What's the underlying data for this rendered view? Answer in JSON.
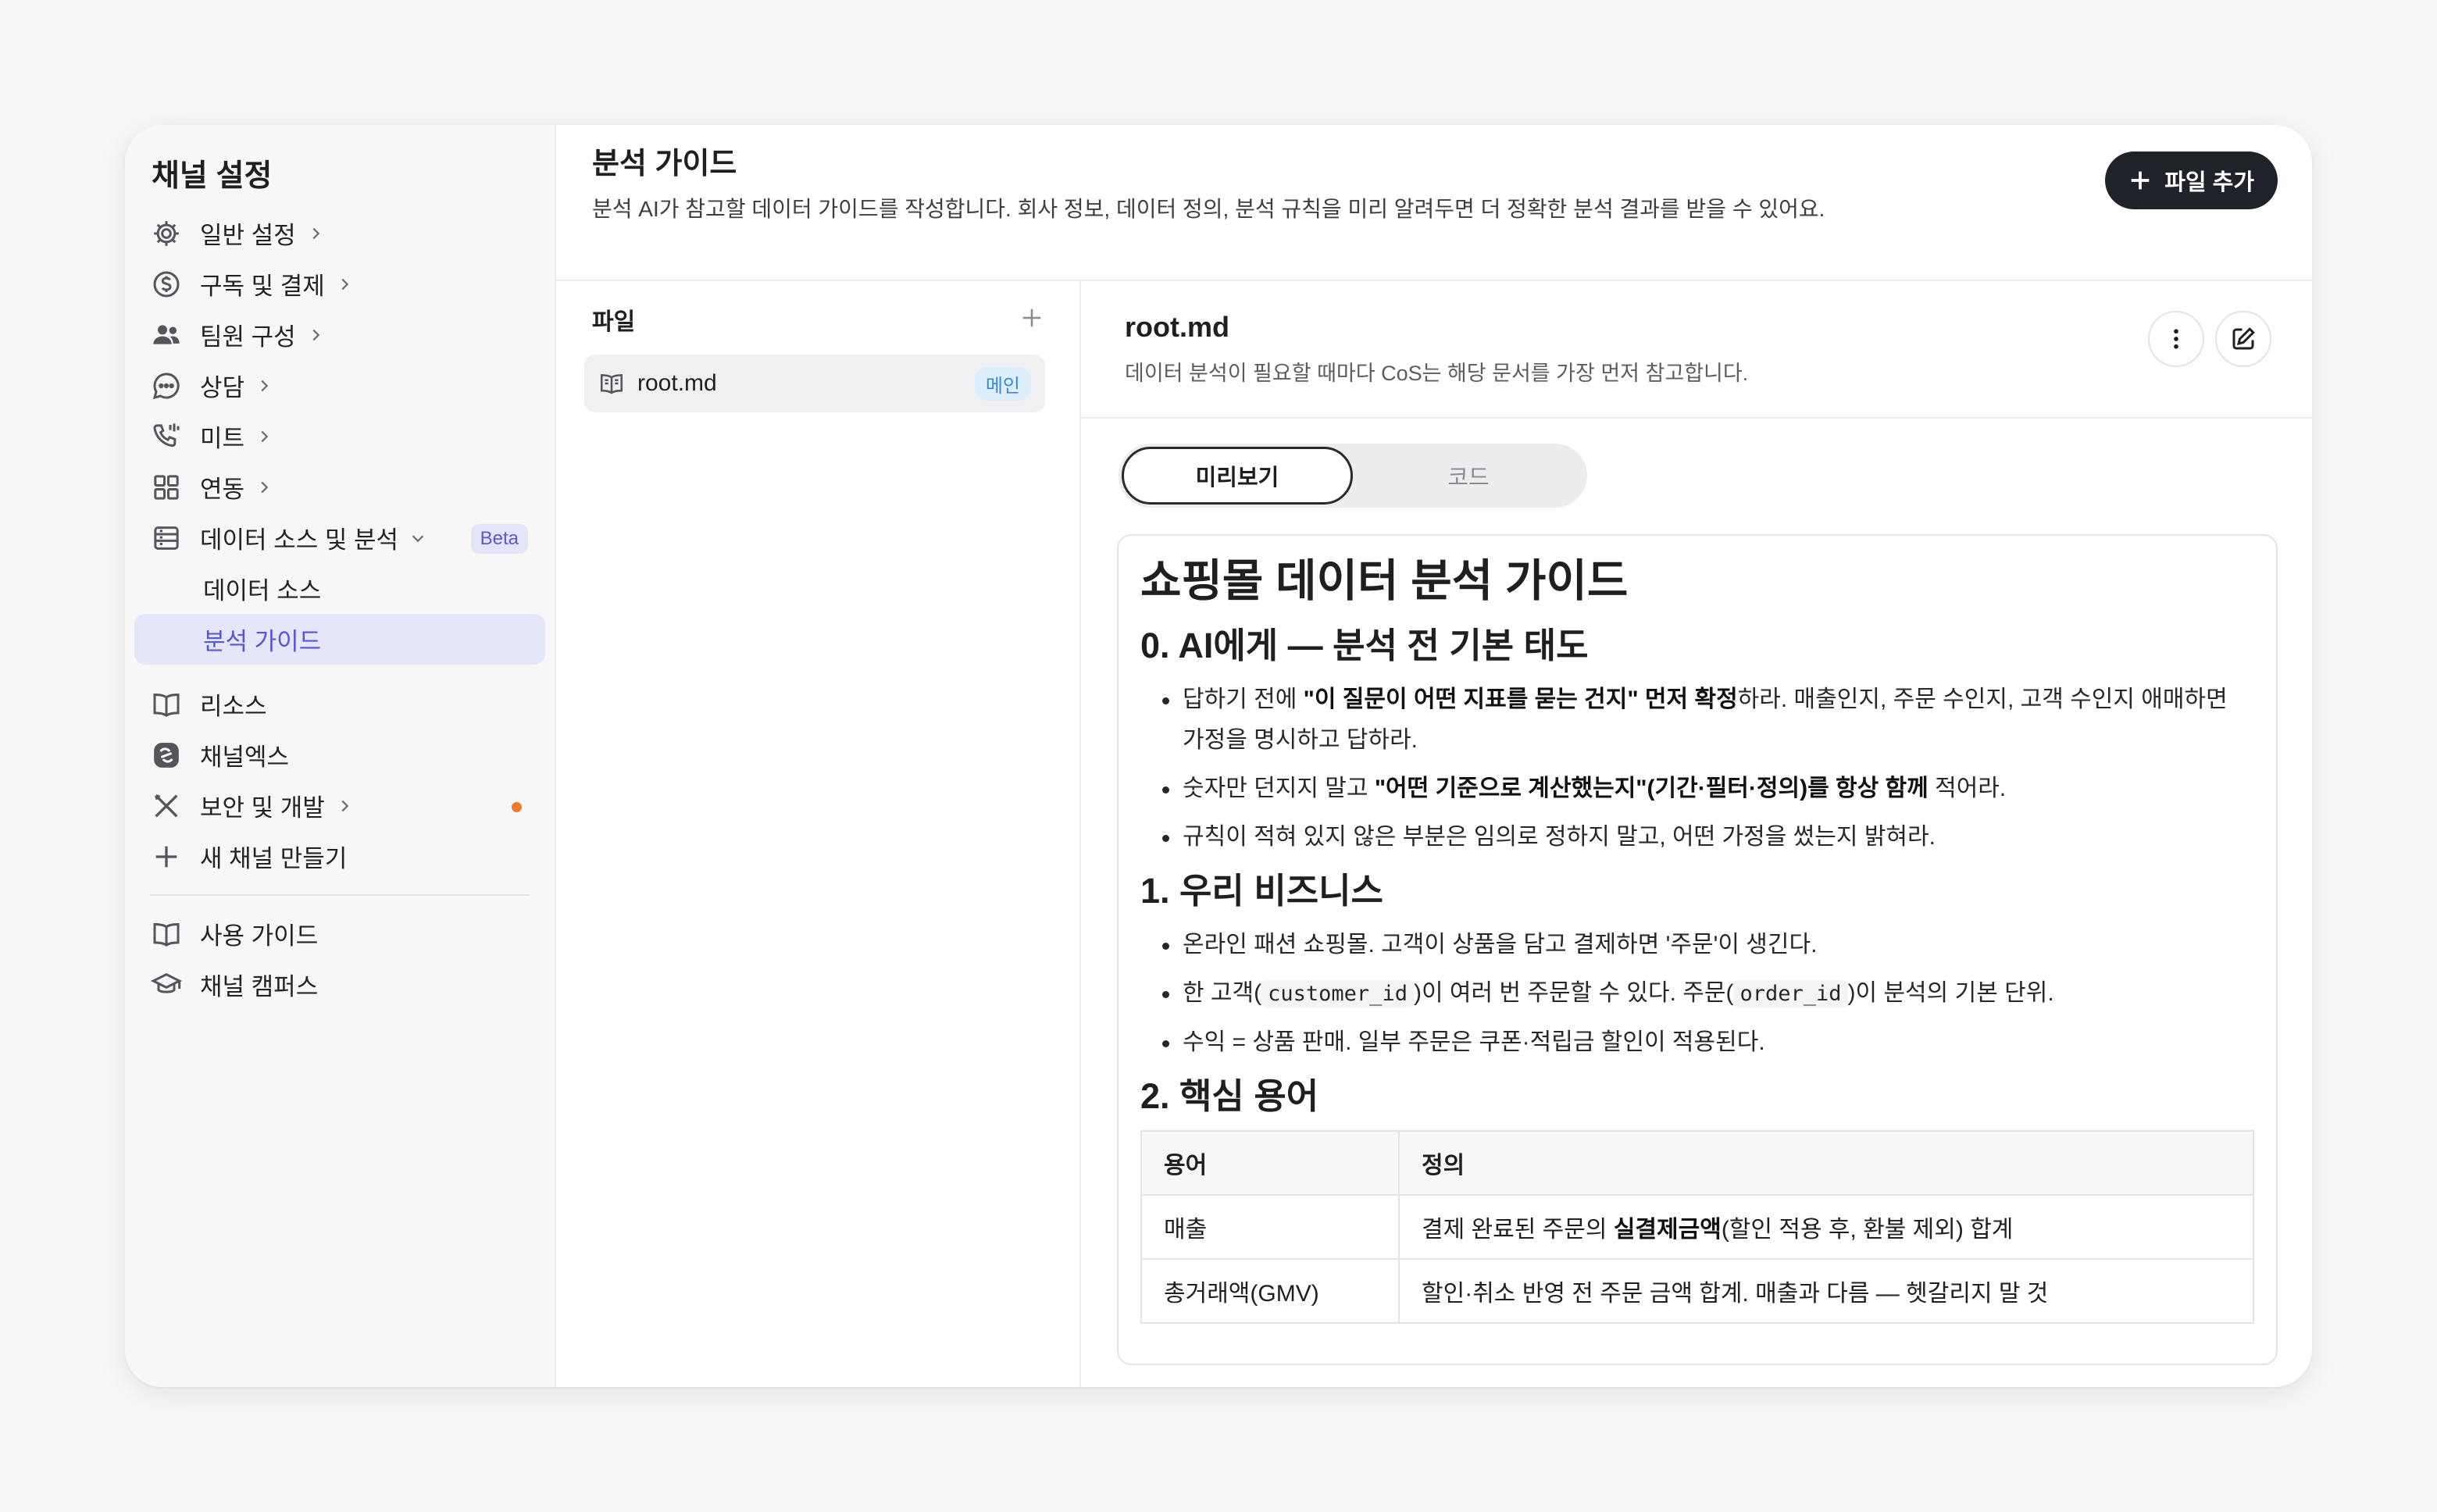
{
  "sidebar": {
    "title": "채널 설정",
    "items": [
      {
        "label": "일반 설정"
      },
      {
        "label": "구독 및 결제"
      },
      {
        "label": "팀원 구성"
      },
      {
        "label": "상담"
      },
      {
        "label": "미트"
      },
      {
        "label": "연동"
      },
      {
        "label": "데이터 소스 및 분석",
        "badge": "Beta"
      },
      {
        "label": "데이터 소스"
      },
      {
        "label": "분석 가이드"
      },
      {
        "label": "리소스"
      },
      {
        "label": "채널엑스"
      },
      {
        "label": "보안 및 개발"
      },
      {
        "label": "새 채널 만들기"
      },
      {
        "label": "사용 가이드"
      },
      {
        "label": "채널 캠퍼스"
      }
    ],
    "accent_color": "#5656d8",
    "notice_dot_color": "#f07a2c"
  },
  "header": {
    "title": "분석 가이드",
    "description": "분석 AI가 참고할 데이터 가이드를 작성합니다. 회사 정보, 데이터 정의, 분석 규칙을 미리 알려두면 더 정확한 분석 결과를 받을 수 있어요.",
    "add_file_label": "파일 추가"
  },
  "files": {
    "title": "파일",
    "items": [
      {
        "name": "root.md",
        "badge": "메인"
      }
    ]
  },
  "document": {
    "name": "root.md",
    "description": "데이터 분석이 필요할 때마다 CoS는 해당 문서를 가장 먼저 참고합니다.",
    "tabs": {
      "preview": "미리보기",
      "code": "코드"
    },
    "h1": "쇼핑몰 데이터 분석 가이드",
    "sections": [
      {
        "title": "0. AI에게 — 분석 전 기본 태도",
        "bullets": [
          {
            "pre": "답하기 전에 ",
            "bold": "\"이 질문이 어떤 지표를 묻는 건지\" 먼저 확정",
            "post": "하라. 매출인지, 주문 수인지, 고객 수인지 애매하면 가정을 명시하고 답하라."
          },
          {
            "pre": "숫자만 던지지 말고 ",
            "bold": "\"어떤 기준으로 계산했는지\"(기간·필터·정의)를 항상 함께",
            "post": " 적어라."
          },
          {
            "pre": "규칙이 적혀 있지 않은 부분은 임의로 정하지 말고, 어떤 가정을 썼는지 밝혀라.",
            "bold": "",
            "post": ""
          }
        ]
      },
      {
        "title": "1. 우리 비즈니스",
        "bullets": [
          {
            "text": "온라인 패션 쇼핑몰. 고객이 상품을 담고 결제하면 '주문'이 생긴다."
          },
          {
            "t1": "한 고객(",
            "c1": "customer_id",
            "t2": ")이 여러 번 주문할 수 있다. 주문(",
            "c2": "order_id",
            "t3": ")이 분석의 기본 단위."
          },
          {
            "text": "수익 = 상품 판매. 일부 주문은 쿠폰·적립금 할인이 적용된다."
          }
        ]
      },
      {
        "title": "2. 핵심 용어",
        "table": {
          "headers": [
            "용어",
            "정의"
          ],
          "rows": [
            {
              "term": "매출",
              "pre": "결제 완료된 주문의 ",
              "bold": "실결제금액",
              "post": "(할인 적용 후, 환불 제외) 합계"
            },
            {
              "term": "총거래액(GMV)",
              "pre": "할인·취소 반영 전 주문 금액 합계. 매출과 다름 — 헷갈리지 말 것",
              "bold": "",
              "post": ""
            }
          ]
        }
      }
    ]
  }
}
